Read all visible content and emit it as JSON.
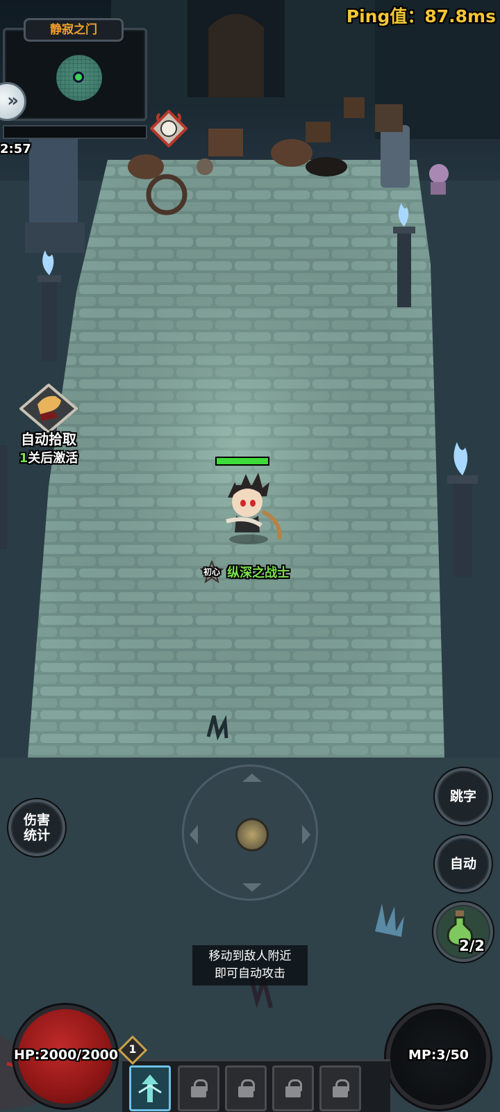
{
  "ping": {
    "label": "Ping值：",
    "value": "87.8ms"
  },
  "minimap": {
    "title": "静寂之门"
  },
  "timer": "2:57",
  "auto_pickup": {
    "label": "自动拾取",
    "count": "1",
    "suffix": "关后激活"
  },
  "hero": {
    "badge": "初心",
    "name": "纵深之战士",
    "hp_fraction": 1.0
  },
  "buttons": {
    "damage_stats": "伤害统计",
    "jump_text": "跳字",
    "auto": "自动"
  },
  "potion": {
    "count": "2/2"
  },
  "hint": {
    "line1": "移动到敌人附近",
    "line2": "即可自动攻击"
  },
  "stats": {
    "hp": "HP:2000/2000",
    "mp": "MP:3/50"
  },
  "skillbar": {
    "level": "1",
    "slots": [
      {
        "state": "active",
        "icon": "arrow-skill-icon"
      },
      {
        "state": "locked",
        "icon": "lock-icon"
      },
      {
        "state": "locked",
        "icon": "lock-icon"
      },
      {
        "state": "locked",
        "icon": "lock-icon"
      },
      {
        "state": "locked",
        "icon": "lock-icon"
      }
    ]
  },
  "colors": {
    "ping": "#f3c634",
    "minimap_title": "#f2a22b",
    "hero_name": "#7be24a",
    "hp": "#a01e1e",
    "torch_flame": "#a8d8ff"
  }
}
